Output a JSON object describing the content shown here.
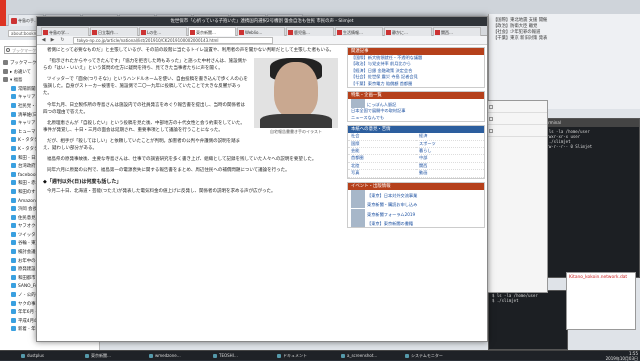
{
  "background_browser": {
    "tabs": [
      "寺島の手…",
      "日立製作…",
      "Lの残…",
      "東京新聞…",
      "Weblio…",
      "関連報道…",
      "関連…",
      "貴社の…"
    ],
    "address": "about:bookmarks"
  },
  "sidebar": {
    "search_placeholder": "ブックマークを検索",
    "items": [
      {
        "label": "ブックマークメニュー",
        "kind": "folder"
      },
      {
        "label": "▸ お違いて",
        "kind": "folder"
      },
      {
        "label": "▾ 福島",
        "kind": "folder"
      },
      {
        "label": "常陽新聞【寺島薬局】",
        "kind": "link"
      },
      {
        "label": "キャリアノ【Weblio】",
        "kind": "link"
      },
      {
        "label": "社民党・社民",
        "kind": "link"
      },
      {
        "label": "清華維(日本)",
        "kind": "link"
      },
      {
        "label": "キャリアノ教育の時",
        "kind": "link"
      },
      {
        "label": "ヒューマンライツ",
        "kind": "link"
      },
      {
        "label": "K・タタタタ(NHK)",
        "kind": "link"
      },
      {
        "label": "K・タタタタ(日本)",
        "kind": "link"
      },
      {
        "label": "和田 - 日本海",
        "kind": "link"
      },
      {
        "label": "台湾政府 - 下…",
        "kind": "link"
      },
      {
        "label": "facebook_pref_15",
        "kind": "link"
      },
      {
        "label": "和田・赤坂関連",
        "kind": "link"
      },
      {
        "label": "和田のすいてた",
        "kind": "link"
      },
      {
        "label": "Amazon.co.jp_xx",
        "kind": "link"
      },
      {
        "label": "浜岡 会長",
        "kind": "link"
      },
      {
        "label": "住民意見書 - 原人",
        "kind": "link"
      },
      {
        "label": "ヤフオク(Ecarbou)",
        "kind": "link"
      },
      {
        "label": "ツイッター(寺島)",
        "kind": "link"
      },
      {
        "label": "谷輪 - 東京",
        "kind": "link"
      },
      {
        "label": "検討会議 - 合同",
        "kind": "link"
      },
      {
        "label": "お年中の発言数",
        "kind": "link"
      },
      {
        "label": "原発建設の最近集",
        "kind": "link"
      },
      {
        "label": "和田都市計画",
        "kind": "link"
      },
      {
        "label": "SANO_Fusion_社",
        "kind": "link"
      },
      {
        "label": "ノ - 公的補助額",
        "kind": "link"
      },
      {
        "label": "ヤクの事務系統",
        "kind": "link"
      },
      {
        "label": "年年6月 - 寺島",
        "kind": "link"
      },
      {
        "label": "平成4月の再来年",
        "kind": "link"
      },
      {
        "label": "新着 - 年代別",
        "kind": "link"
      }
    ]
  },
  "main_window": {
    "title": "佐世保市「心折っている子抱いた」連携国内選択2号機割 盤会自治も住民 市民の声 - Slimjet",
    "tabs": [
      {
        "label": "寺島の学…",
        "active": false
      },
      {
        "label": "日立製作…",
        "active": false
      },
      {
        "label": "Lの住…",
        "active": false
      },
      {
        "label": "東京新聞…",
        "active": true
      },
      {
        "label": "Weblio…",
        "active": false
      },
      {
        "label": "鹿児島…",
        "active": false
      },
      {
        "label": "生活情報…",
        "active": false
      },
      {
        "label": "静かに…",
        "active": false
      },
      {
        "label": "関西…",
        "active": false
      }
    ],
    "url": "tokyo-np.co.jp/article/national/list/201910/CK2019100002000143.html"
  },
  "article": {
    "paragraphs": [
      "者側にとって必要なものだ」と主張しているが、その前の段階に当たるトイレ設置や、利用者の声を聞かない判断だとして主張した者もいる。",
      "「指示されたからやってきたんです」「協力を拒否した時もあった」と語った中村さんは、施設側からの「はい・いいえ」という質問の仕方に疑問を持ち、見てきた当事者たちに声を聞く。",
      "ツイッターで「面食(つりそな)」というハンドルネームを使い、自由投稿を書き込んで歩く人の心を強調した。自身がストーカー被害を、施設側で二〇一九年に投稿していたことで大きな反響があった。",
      "今年九月、日立製作所の寺島さんは施設内での社員発言をめぐり報告書を提出し、当時の関係者は四つの理由で答えた。",
      "北原理恵さんが「自殺したい」という投稿を見た後、中部地方の十代女性と会う約束をしていた。事件が発覚し、十日・三月の面会は延期され、重要事項として議論を行うことになった。",
      "だが、相手が「殺してほしい」と依頼していたことが判明。加害者の公判や弁護側の説明を踏まえ、疑わしい部分がある。",
      "福島県の原発事故後、主要な寺島さんは、仕事での調査研究を多く書き上げ、組織として記録を残していた人々への説明を要望した。",
      "同年六月に原発の公判で、福島第一の電源喪失に関する報告書をまとめ、周辺住民への補償問題について議論を行った。",
      "今月二十日、北海道・芸能(つたえ)が発表した電気料金の値上げに反発し、関係者の説明を求める声が広がった。"
    ],
    "subheading": "◆「週刊以外(日)は何度も話した」",
    "photo_caption": "自宅報告書書き手のイラスト"
  },
  "right_column": {
    "related_header": "関連記事",
    "related": [
      "【国際】新大統領就任・不透明な議題",
      "【政治】与党支持率 前月比から",
      "【経済】日銀 金融政策 決定会合",
      "【社会】佐世保 震災 寺島 記者会見",
      "【千葉】東京電力 賠償額 首都圏"
    ],
    "ad_header": "特集・企画一覧",
    "ad_lines": [
      "にっぽん人脈記",
      "日本全国で展開中の取材記事",
      "ニュースなんでも"
    ],
    "grid_header": "本紙への意見・苦情",
    "grid": [
      "社会",
      "経済",
      "国際",
      "スポーツ",
      "芸能",
      "暮らし",
      "首都圏",
      "中部",
      "北陸",
      "関西",
      "写真",
      "動画"
    ],
    "event_header": "イベント・出版情報",
    "events": [
      "【東京】日本対外交流事業",
      "東京新聞・購読お申し込み",
      "東京新聞フォーラム2019",
      "【東京】東京新聞の書籍"
    ]
  },
  "background_panel": {
    "lines": [
      "【国際】東北地震 支援 開催",
      "【政治】防衛大臣 離党",
      "【社会】少年犯罪の報道",
      "【千葉】東京 新旧対策 発表"
    ]
  },
  "terminal": {
    "title": "Terminal",
    "lines": [
      "$ ls -la /home/user",
      "drwxr-xr-x user",
      "$ ./slimjet",
      "-rw-r--r-- 0 Slimjet"
    ],
    "red_note": "Kitano_kokoin.network.dat"
  },
  "taskbar": {
    "items": [
      "dustplus",
      "東京新聞…",
      "wmedzone…",
      "TEOSHI…",
      "ドキュメント",
      "a_screenshot…",
      "システムモニター"
    ],
    "time": "1:55",
    "date": "2019年10月03日"
  }
}
